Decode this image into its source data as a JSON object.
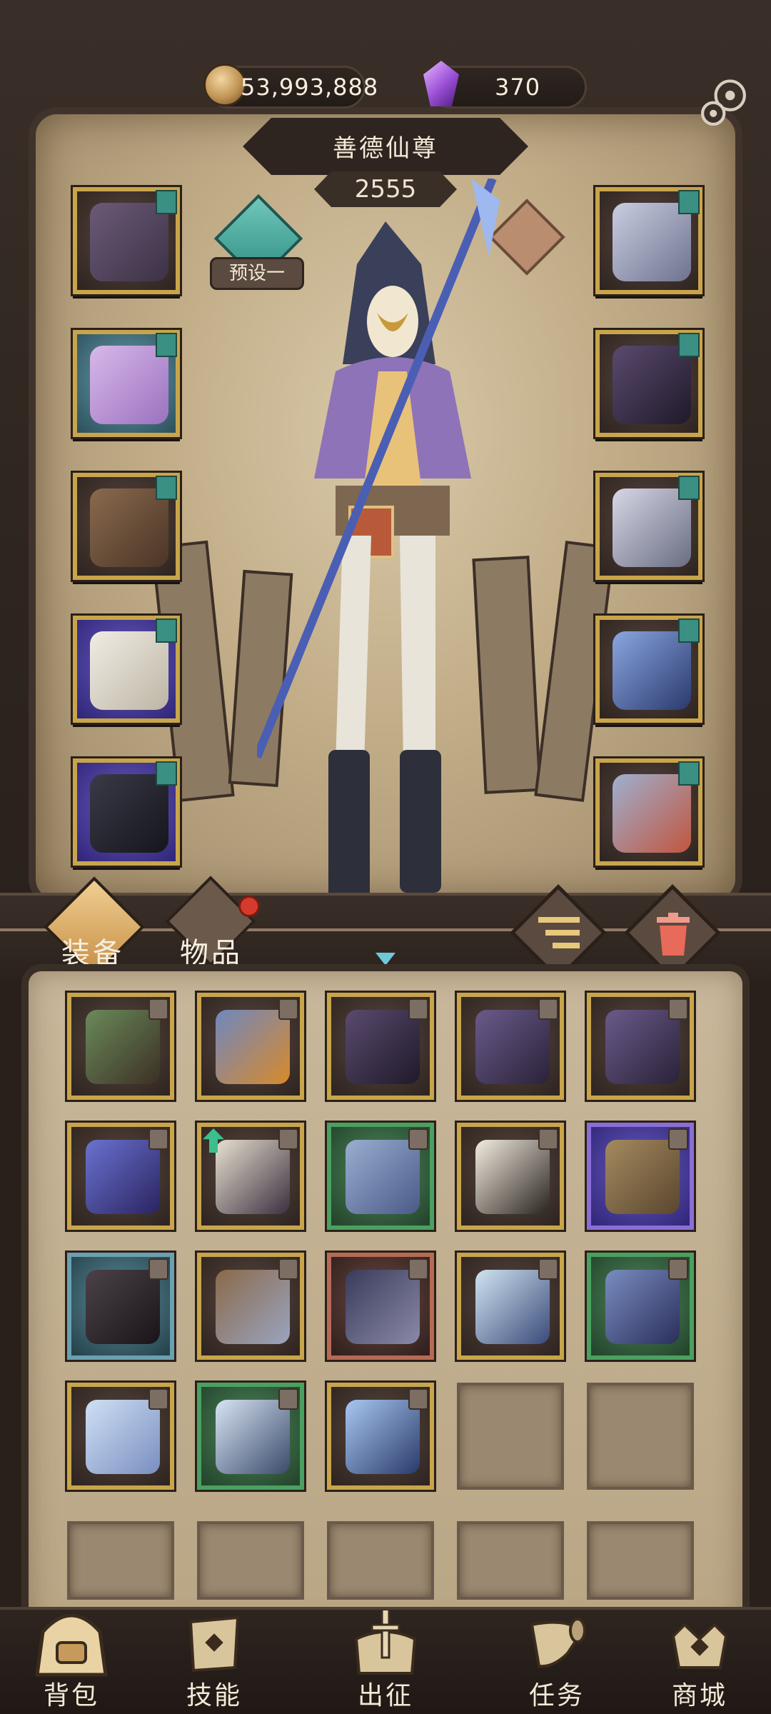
{
  "currencies": {
    "gold": {
      "icon": "gold-coin-icon",
      "value": "53,993,888"
    },
    "gems": {
      "icon": "purple-gem-icon",
      "value": "370"
    }
  },
  "character": {
    "name": "善德仙尊",
    "power": "2555",
    "preset_label": "预设一"
  },
  "equipment": {
    "left": [
      {
        "slot": "emblem",
        "icon": "star-emblem-icon",
        "rarity": "gold"
      },
      {
        "slot": "armor",
        "icon": "purple-robe-icon",
        "rarity": "teal"
      },
      {
        "slot": "gloves",
        "icon": "leather-bracer-icon",
        "rarity": "gold"
      },
      {
        "slot": "pants",
        "icon": "white-trousers-icon",
        "rarity": "purple"
      },
      {
        "slot": "boots",
        "icon": "black-boots-icon",
        "rarity": "purple"
      }
    ],
    "right": [
      {
        "slot": "amulet",
        "icon": "silver-amulet-icon",
        "rarity": "gold"
      },
      {
        "slot": "ring",
        "icon": "claw-ring-icon",
        "rarity": "gold"
      },
      {
        "slot": "offhand",
        "icon": "crescent-icon",
        "rarity": "gold"
      },
      {
        "slot": "weapon",
        "icon": "spear-icon",
        "rarity": "gold"
      },
      {
        "slot": "tome",
        "icon": "spellbook-icon",
        "rarity": "gold"
      }
    ]
  },
  "tabs": {
    "equipment": "装备",
    "items": "物品",
    "items_has_badge": true
  },
  "inventory": [
    {
      "icon": "nature-staff-icon",
      "rarity": "gold",
      "locked": true
    },
    {
      "icon": "orb-tome-icon",
      "rarity": "gold",
      "locked": true
    },
    {
      "icon": "claw-ring-icon",
      "rarity": "gold",
      "locked": true
    },
    {
      "icon": "bone-gauntlet-icon",
      "rarity": "gold",
      "locked": true
    },
    {
      "icon": "bone-gauntlet-icon",
      "rarity": "gold",
      "locked": true
    },
    {
      "icon": "blue-amulet-icon",
      "rarity": "gold",
      "locked": true
    },
    {
      "icon": "coat-icon",
      "rarity": "gold",
      "locked": true,
      "upgrade": true
    },
    {
      "icon": "scale-bracer-icon",
      "rarity": "green",
      "locked": true
    },
    {
      "icon": "white-gloves-icon",
      "rarity": "gold",
      "locked": true
    },
    {
      "icon": "leather-boots-icon",
      "rarity": "purple",
      "locked": true
    },
    {
      "icon": "dark-boots-icon",
      "rarity": "teal",
      "locked": true
    },
    {
      "icon": "armored-boots-icon",
      "rarity": "gold",
      "locked": true
    },
    {
      "icon": "dark-sword-icon",
      "rarity": "red",
      "locked": true
    },
    {
      "icon": "crystal-wand-icon",
      "rarity": "gold",
      "locked": true
    },
    {
      "icon": "scale-skirt-icon",
      "rarity": "green",
      "locked": true
    },
    {
      "icon": "halo-boots-icon",
      "rarity": "gold",
      "locked": true
    },
    {
      "icon": "ice-crown-icon",
      "rarity": "green",
      "locked": true
    },
    {
      "icon": "ice-blade-icon",
      "rarity": "gold",
      "locked": true
    },
    {
      "icon": "",
      "rarity": "empty",
      "locked": false
    },
    {
      "icon": "",
      "rarity": "empty",
      "locked": false
    },
    {
      "icon": "",
      "rarity": "empty",
      "locked": false
    },
    {
      "icon": "",
      "rarity": "empty",
      "locked": false
    },
    {
      "icon": "",
      "rarity": "empty",
      "locked": false
    },
    {
      "icon": "",
      "rarity": "empty",
      "locked": false
    },
    {
      "icon": "",
      "rarity": "empty",
      "locked": false
    }
  ],
  "nav": [
    {
      "label": "背包",
      "icon": "backpack-icon",
      "active": true
    },
    {
      "label": "技能",
      "icon": "skill-scroll-icon",
      "active": false
    },
    {
      "label": "出征",
      "icon": "expedition-sword-icon",
      "active": false
    },
    {
      "label": "任务",
      "icon": "quest-horn-icon",
      "active": false
    },
    {
      "label": "商城",
      "icon": "shop-crown-icon",
      "active": false
    }
  ],
  "colors": {
    "gold_frame": "#c8a54c",
    "green_frame": "#4aa060",
    "purple_frame": "#8a6ed6",
    "teal_accent": "#3b8f83",
    "badge_red": "#d63a2c"
  }
}
